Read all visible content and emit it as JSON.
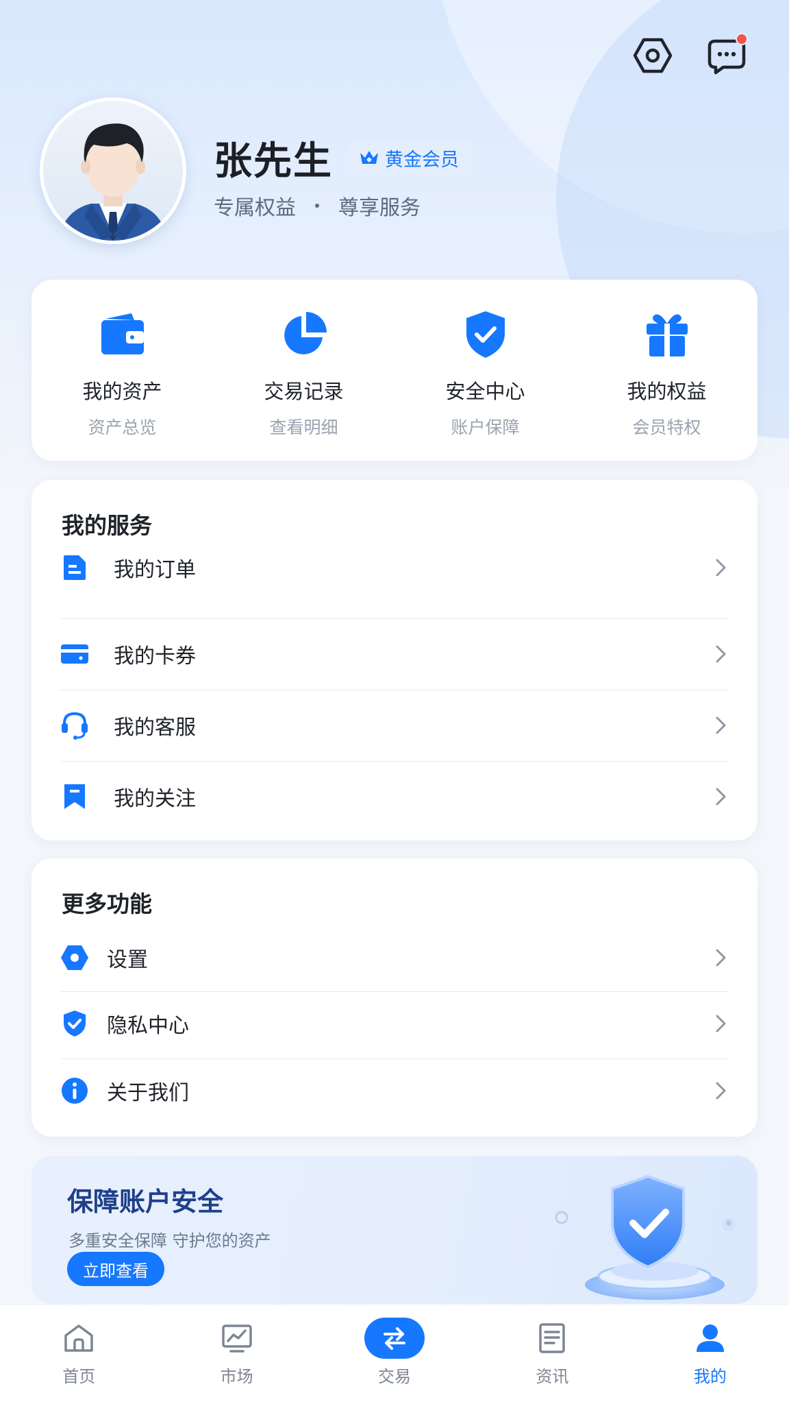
{
  "profile": {
    "name": "张先生",
    "badge": "黄金会员",
    "subtitle_left": "专属权益",
    "subtitle_right": "尊享服务"
  },
  "quick_actions": [
    {
      "label": "我的资产",
      "sub": "资产总览",
      "icon": "wallet-icon"
    },
    {
      "label": "交易记录",
      "sub": "查看明细",
      "icon": "pie-chart-icon"
    },
    {
      "label": "安全中心",
      "sub": "账户保障",
      "icon": "shield-check-icon"
    },
    {
      "label": "我的权益",
      "sub": "会员特权",
      "icon": "gift-icon"
    }
  ],
  "services": {
    "title": "我的服务",
    "items": [
      {
        "label": "我的订单",
        "icon": "document-icon"
      },
      {
        "label": "我的卡券",
        "icon": "card-icon"
      },
      {
        "label": "我的客服",
        "icon": "headset-icon"
      },
      {
        "label": "我的关注",
        "icon": "bookmark-icon"
      }
    ]
  },
  "more": {
    "title": "更多功能",
    "items": [
      {
        "label": "设置",
        "icon": "settings-icon"
      },
      {
        "label": "隐私中心",
        "icon": "privacy-shield-icon"
      },
      {
        "label": "关于我们",
        "icon": "info-icon"
      }
    ]
  },
  "banner": {
    "title": "保障账户安全",
    "subtitle": "多重安全保障  守护您的资产",
    "button": "立即查看"
  },
  "nav": [
    {
      "label": "首页",
      "icon": "home-icon"
    },
    {
      "label": "市场",
      "icon": "market-chart-icon"
    },
    {
      "label": "交易",
      "icon": "swap-icon"
    },
    {
      "label": "资讯",
      "icon": "news-icon"
    },
    {
      "label": "我的",
      "icon": "user-icon",
      "active": true
    }
  ],
  "colors": {
    "primary": "#1677ff",
    "notification_dot": "#f5534a",
    "background": "#f3f6fb"
  }
}
